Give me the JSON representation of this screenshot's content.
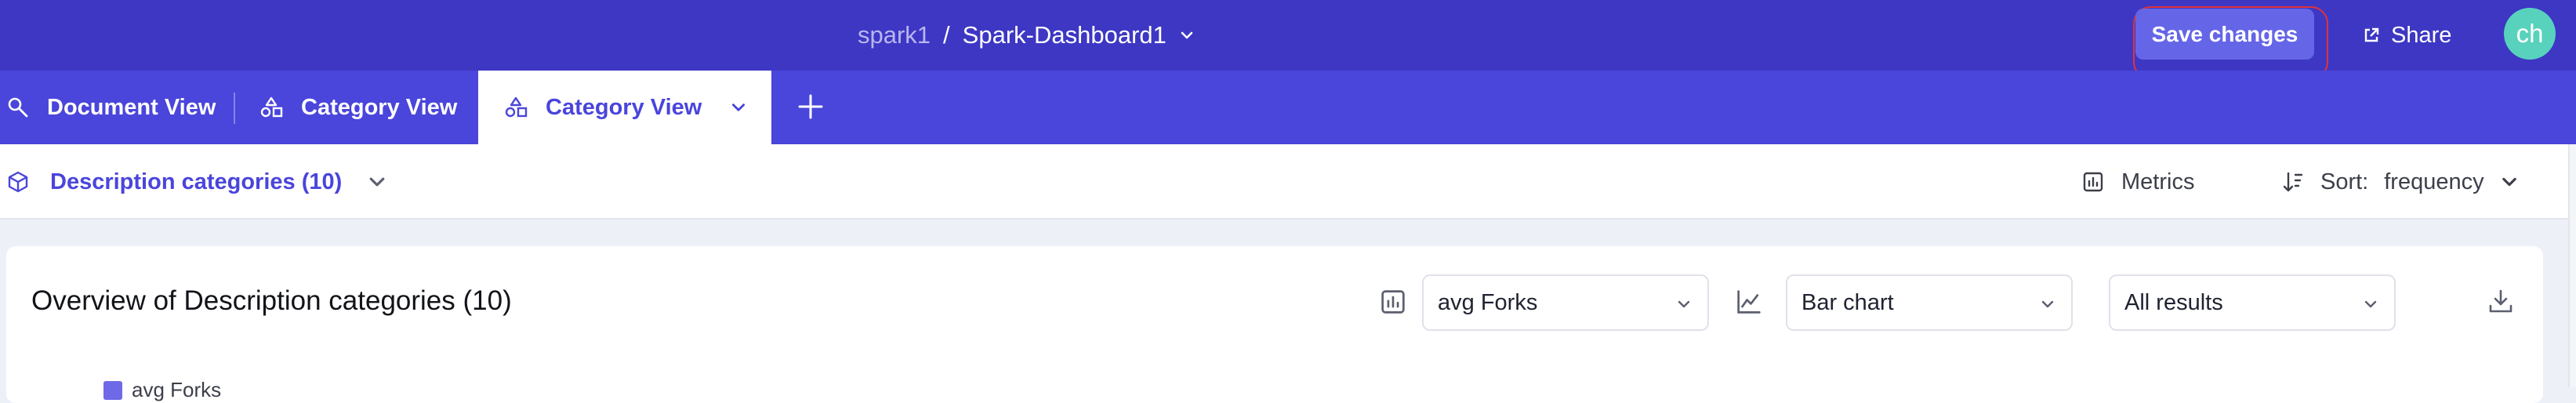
{
  "header": {
    "workspace": "spark1",
    "separator": "/",
    "dashboard_name": "Spark-Dashboard1",
    "save_label": "Save changes",
    "share_label": "Share",
    "avatar_initials": "ch"
  },
  "tabs": [
    {
      "label": "Document View",
      "icon": "search-icon"
    },
    {
      "label": "Category View",
      "icon": "shapes-icon"
    },
    {
      "label": "Category View",
      "icon": "shapes-icon",
      "active": true
    }
  ],
  "subbar": {
    "category_label": "Description categories (10)",
    "metrics_label": "Metrics",
    "sort_prefix": "Sort:",
    "sort_value": "frequency"
  },
  "card": {
    "title": "Overview of Description categories (10)",
    "metric_select": "avg Forks",
    "chart_type_select": "Bar chart",
    "results_select": "All results",
    "legend_label": "avg Forks"
  },
  "colors": {
    "topbar": "#3d37c4",
    "tabbar": "#4a45db",
    "accent": "#4a45db",
    "save_button": "#6565e8",
    "avatar": "#58d2bd",
    "highlight_outline": "#e0323a"
  }
}
